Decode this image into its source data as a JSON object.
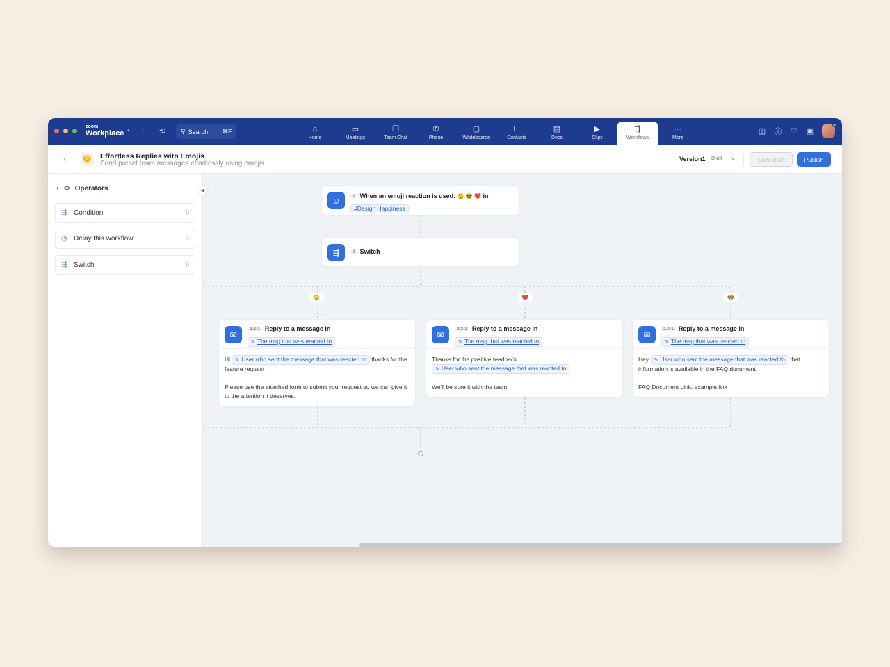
{
  "app": {
    "brand_small": "zoom",
    "brand_name": "Workplace",
    "search_label": "Search",
    "search_shortcut": "⌘F",
    "traffic_colors": [
      "#ec6a5e",
      "#f4bf4f",
      "#61c554"
    ],
    "accent": "#2f6fe0",
    "topbar_color": "#1d3b8f"
  },
  "nav": {
    "tabs": [
      {
        "label": "Home",
        "icon": "⌂"
      },
      {
        "label": "Meetings",
        "icon": "▭"
      },
      {
        "label": "Team Chat",
        "icon": "❐"
      },
      {
        "label": "Phone",
        "icon": "✆"
      },
      {
        "label": "Whiteboards",
        "icon": "▢"
      },
      {
        "label": "Contacts",
        "icon": "☐"
      },
      {
        "label": "Docs",
        "icon": "▤"
      },
      {
        "label": "Clips",
        "icon": "▶"
      },
      {
        "label": "Workflows",
        "icon": "⇶",
        "active": true
      },
      {
        "label": "More",
        "icon": "···"
      }
    ]
  },
  "header": {
    "title": "Effortless Replies with Emojis",
    "subtitle": "Send preset team messages effortlessly using emojis",
    "app_emoji": "😊",
    "version": "Version1",
    "status": "Draft",
    "save_draft": "Save draft",
    "publish": "Publish"
  },
  "sidebar": {
    "title": "Operators",
    "items": [
      {
        "label": "Condition",
        "icon": "⇶"
      },
      {
        "label": "Delay this workflow",
        "icon": "◷"
      },
      {
        "label": "Switch",
        "icon": "⇶"
      }
    ]
  },
  "workflow": {
    "trigger": {
      "step": "1",
      "text": "When an emoji reaction is used:",
      "emojis": "🤤 🤓 ❤️",
      "suffix": "in",
      "channel": "#Design Happiness"
    },
    "switch": {
      "step": "2",
      "label": "Switch"
    },
    "branches": [
      {
        "emoji": "🤤"
      },
      {
        "emoji": "❤️"
      },
      {
        "emoji": "🤓"
      }
    ],
    "replies": [
      {
        "step": "2.2-1",
        "title": "Reply to a message in",
        "target": "The msg that was reacted to",
        "pre": "Hi",
        "chip": "User who sent the message that was reacted to",
        "post": "thanks for the feature request",
        "para2": "Please use the attached form to submit your request so we can give it to the attention it deserves."
      },
      {
        "step": "2.3-1",
        "title": "Reply to a message in",
        "target": "The msg that was reacted to",
        "pre": "Thanks for the positive feedback",
        "chip": "User who sent the message that was reacted to",
        "post": ".",
        "para2": "We'll be sure it with the team!"
      },
      {
        "step": "2.4-1",
        "title": "Reply to a message in",
        "target": "The msg that was reacted to",
        "pre": "Hey",
        "chip": "User who sent the message that was reacted to",
        "post": "that information is available in the FAQ document.",
        "para2": "FAQ Document Link: example.link"
      }
    ]
  }
}
